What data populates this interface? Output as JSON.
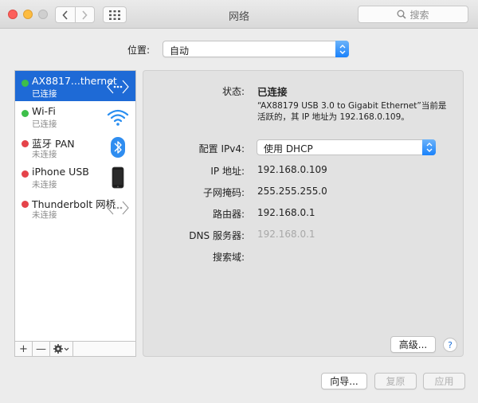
{
  "window": {
    "title": "网络",
    "search_placeholder": "搜索"
  },
  "location": {
    "label": "位置:",
    "value": "自动"
  },
  "services": [
    {
      "name": "AX8817...thernet",
      "status": "已连接",
      "dot_color": "#3dbf4a",
      "icon": "ethernet-icon",
      "selected": true
    },
    {
      "name": "Wi-Fi",
      "status": "已连接",
      "dot_color": "#3dbf4a",
      "icon": "wifi-icon",
      "selected": false
    },
    {
      "name": "蓝牙 PAN",
      "status": "未连接",
      "dot_color": "#e5434a",
      "icon": "bluetooth-icon",
      "selected": false
    },
    {
      "name": "iPhone USB",
      "status": "未连接",
      "dot_color": "#e5434a",
      "icon": "iphone-icon",
      "selected": false
    },
    {
      "name": "Thunderbolt 网桥",
      "status": "未连接",
      "dot_color": "#e5434a",
      "icon": "thunderbolt-bridge-icon",
      "selected": false
    }
  ],
  "toolbar": {
    "add": "+",
    "remove": "—"
  },
  "detail": {
    "status_label": "状态:",
    "status_value": "已连接",
    "status_desc_line1": "“AX88179 USB 3.0 to Gigabit Ethernet”当前是",
    "status_desc_line2": "活跃的，其 IP 地址为 192.168.0.109。",
    "ipv4_label": "配置 IPv4:",
    "ipv4_value": "使用 DHCP",
    "ip_label": "IP 地址:",
    "ip_value": "192.168.0.109",
    "subnet_label": "子网掩码:",
    "subnet_value": "255.255.255.0",
    "router_label": "路由器:",
    "router_value": "192.168.0.1",
    "dns_label": "DNS 服务器:",
    "dns_value": "192.168.0.1",
    "search_domain_label": "搜索域:",
    "advanced_button": "高级...",
    "help_button": "?"
  },
  "footer": {
    "assist_button": "向导...",
    "revert_button": "复原",
    "apply_button": "应用"
  },
  "colors": {
    "accent": "#1e6ad6",
    "connected": "#3dbf4a",
    "disconnected": "#e5434a",
    "dimmed": "#a8a8a8"
  }
}
